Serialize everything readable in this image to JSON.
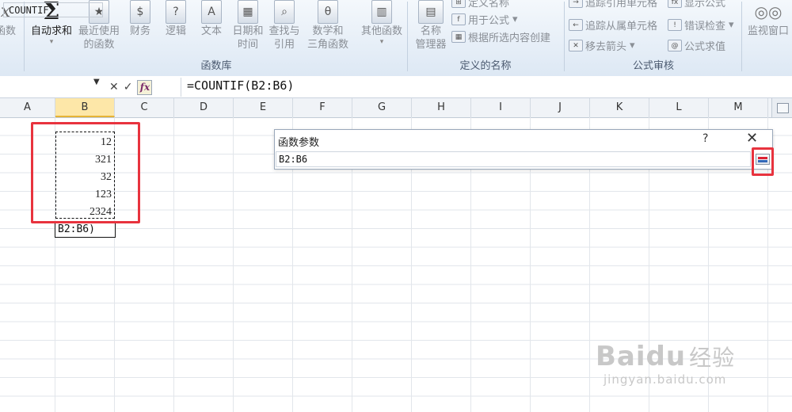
{
  "ribbon": {
    "left_cut_label": "函数",
    "autosum": {
      "icon": "sigma-icon",
      "label": "自动求和"
    },
    "buttons": [
      {
        "label1": "最近使用",
        "label2": "的函数"
      },
      {
        "label1": "财务",
        "label2": ""
      },
      {
        "label1": "逻辑",
        "label2": ""
      },
      {
        "label1": "文本",
        "label2": ""
      },
      {
        "label1": "日期和",
        "label2": "时间"
      },
      {
        "label1": "查找与",
        "label2": "引用"
      },
      {
        "label1": "数学和",
        "label2": "三角函数"
      },
      {
        "label1": "其他函数",
        "label2": ""
      }
    ],
    "library_group": "函数库",
    "names": {
      "manager_line1": "名称",
      "manager_line2": "管理器",
      "define": "定义名称",
      "use_in_formula": "用于公式",
      "create_from_selection": "根据所选内容创建",
      "group": "定义的名称"
    },
    "audit": {
      "trace_precedents": "追踪引用单元格",
      "trace_dependents": "追踪从属单元格",
      "remove_arrows": "移去箭头",
      "show_formulas": "显示公式",
      "error_check": "错误检查",
      "evaluate": "公式求值",
      "group": "公式审核"
    },
    "watch_window": "监视窗口"
  },
  "formula_bar": {
    "name_box": "COUNTIF",
    "formula": "=COUNTIF(B2:B6)"
  },
  "sheet": {
    "columns": [
      "A",
      "B",
      "C",
      "D",
      "E",
      "F",
      "G",
      "H",
      "I",
      "J",
      "K",
      "L",
      "M"
    ],
    "selected_column": "B",
    "values": [
      "12",
      "321",
      "32",
      "123",
      "2324"
    ],
    "editing_text": "B2:B6)"
  },
  "dialog": {
    "title": "函数参数",
    "help": "?",
    "close": "✕",
    "input_value": "B2:B6"
  },
  "watermark": {
    "brand": "Baidu",
    "brand_cn": "经验",
    "url": "jingyan.baidu.com"
  },
  "colors": {
    "highlight_red": "#e8333e",
    "selected_header": "#fde7a8"
  }
}
